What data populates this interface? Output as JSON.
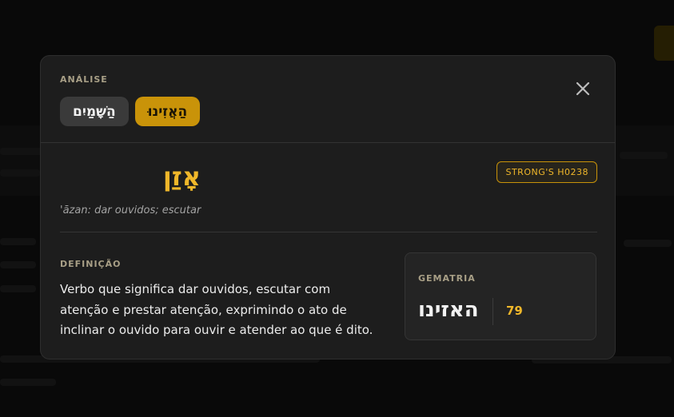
{
  "modal": {
    "header_label": "ANÁLISE",
    "tabs": [
      {
        "label": "הַשָּׁמַיִם",
        "active": false
      },
      {
        "label": "הַאֲזִינוּ",
        "active": true
      }
    ],
    "close_icon": "close-icon"
  },
  "word": {
    "hebrew": "אָזַן",
    "transliteration": "'āzan: dar ouvidos; escutar",
    "strongs": "STRONG'S H0238"
  },
  "definition": {
    "label": "DEFINIÇÃO",
    "text": "Verbo que significa dar ouvidos, escutar com atenção e prestar atenção, exprimindo o ato de inclinar o ouvido para ouvir e atender ao que é dito."
  },
  "gematria": {
    "label": "GEMATRIA",
    "word": "האזינו",
    "value": "79"
  },
  "colors": {
    "accent": "#c99309",
    "accent_text": "#f0b72a",
    "modal_bg": "#1d1d1d",
    "backdrop": "#0b0b0b"
  }
}
